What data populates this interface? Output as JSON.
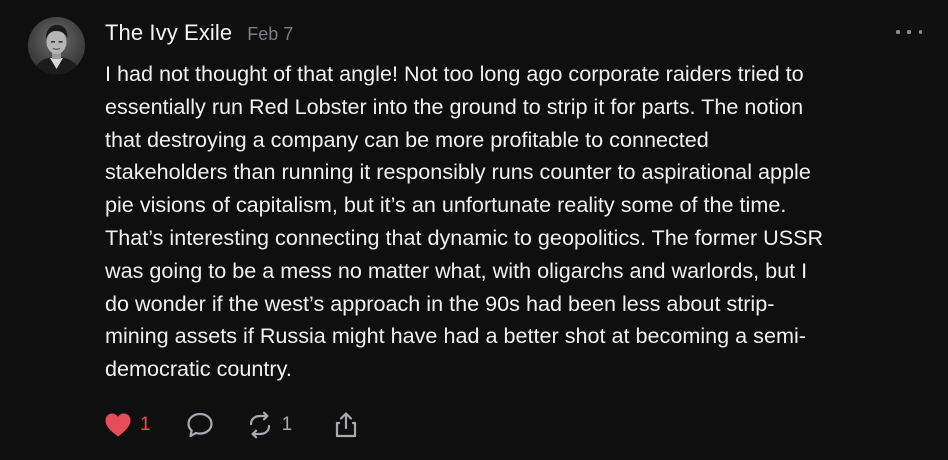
{
  "comment": {
    "author": "The Ivy Exile",
    "date": "Feb 7",
    "body_lines": [
      "I had not thought of that angle! Not too long ago corporate raiders tried to",
      "essentially run Red Lobster into the ground to strip it for parts. The notion",
      "that destroying a company can be more profitable to connected",
      "stakeholders than running it responsibly runs counter to aspirational apple",
      "pie visions of capitalism, but it’s an unfortunate reality some of the time.",
      "That’s interesting connecting that dynamic to geopolitics. The former USSR",
      "was going to be a mess no matter what, with oligarchs and warlords, but I",
      "do wonder if the west’s approach in the 90s had been less about strip-",
      "mining assets if Russia might have had a better shot at becoming a semi-",
      "democratic country."
    ],
    "actions": {
      "like": {
        "count": "1",
        "icon": "heart-icon",
        "liked": true
      },
      "reply": {
        "icon": "comment-bubble-icon"
      },
      "restack": {
        "count": "1",
        "icon": "restack-icon"
      },
      "share": {
        "icon": "share-icon"
      }
    },
    "more_icon": "ellipsis-icon"
  },
  "colors": {
    "background": "#0f0f10",
    "text": "#f0f0f0",
    "muted": "#7d7d82",
    "like": "#e84c59"
  }
}
